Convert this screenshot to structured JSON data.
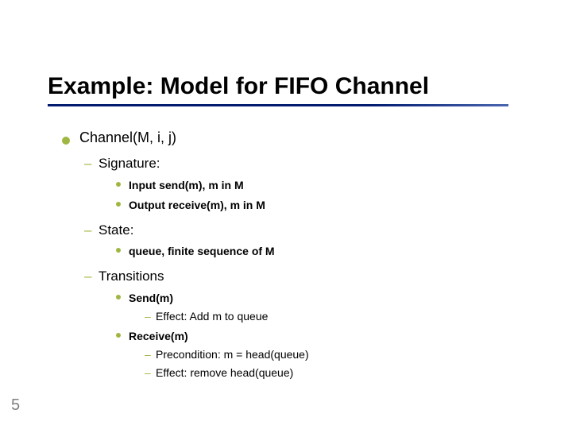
{
  "slide": {
    "title": "Example:  Model for FIFO Channel",
    "page_number": "5",
    "bullet1": "Channel(M, i, j)",
    "sig": {
      "label": "Signature:",
      "input": "Input send(m), m in M",
      "output": "Output receive(m), m in M"
    },
    "state": {
      "label": "State:",
      "queue": "queue, finite sequence of M"
    },
    "trans": {
      "label": "Transitions",
      "send": {
        "name": "Send(m)",
        "effect": "Effect:    Add m to queue"
      },
      "recv": {
        "name": "Receive(m)",
        "pre": "Precondition:  m = head(queue)",
        "effect": "Effect:  remove head(queue)"
      }
    }
  }
}
